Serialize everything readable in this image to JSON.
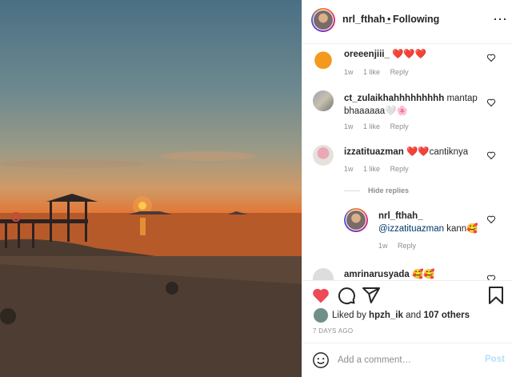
{
  "header": {
    "username": "nrl_fthah_",
    "separator": "•",
    "follow_label": "Following",
    "more_icon": "more-horizontal-icon"
  },
  "comments": [
    {
      "username": "oreeenjiii_",
      "text": "❤️❤️❤️",
      "time": "1w",
      "likes": "1 like",
      "reply": "Reply"
    },
    {
      "username": "ct_zulaikhahhhhhhhhh",
      "text": "mantap bhaaaaaa🤍🌸",
      "time": "1w",
      "likes": "1 like",
      "reply": "Reply"
    },
    {
      "username": "izzatituazman",
      "text": "❤️❤️cantiknya",
      "time": "1w",
      "likes": "1 like",
      "reply": "Reply"
    }
  ],
  "hide_replies": "Hide replies",
  "reply": {
    "username": "nrl_fthah_",
    "mention": "@izzatituazman",
    "text": "kann🥰",
    "time": "1w",
    "reply": "Reply"
  },
  "partial_comment": {
    "username": "amrinarusyada",
    "text": "🥰🥰"
  },
  "likes": {
    "prefix": "Liked by",
    "user": "hpzh_ik",
    "mid": "and",
    "others": "107 others"
  },
  "timestamp": "7 DAYS AGO",
  "add_comment": {
    "placeholder": "Add a comment…",
    "post_label": "Post"
  },
  "colors": {
    "like_red": "#ed4956",
    "link_blue": "#00376b",
    "post_disabled": "#b2dffc"
  }
}
